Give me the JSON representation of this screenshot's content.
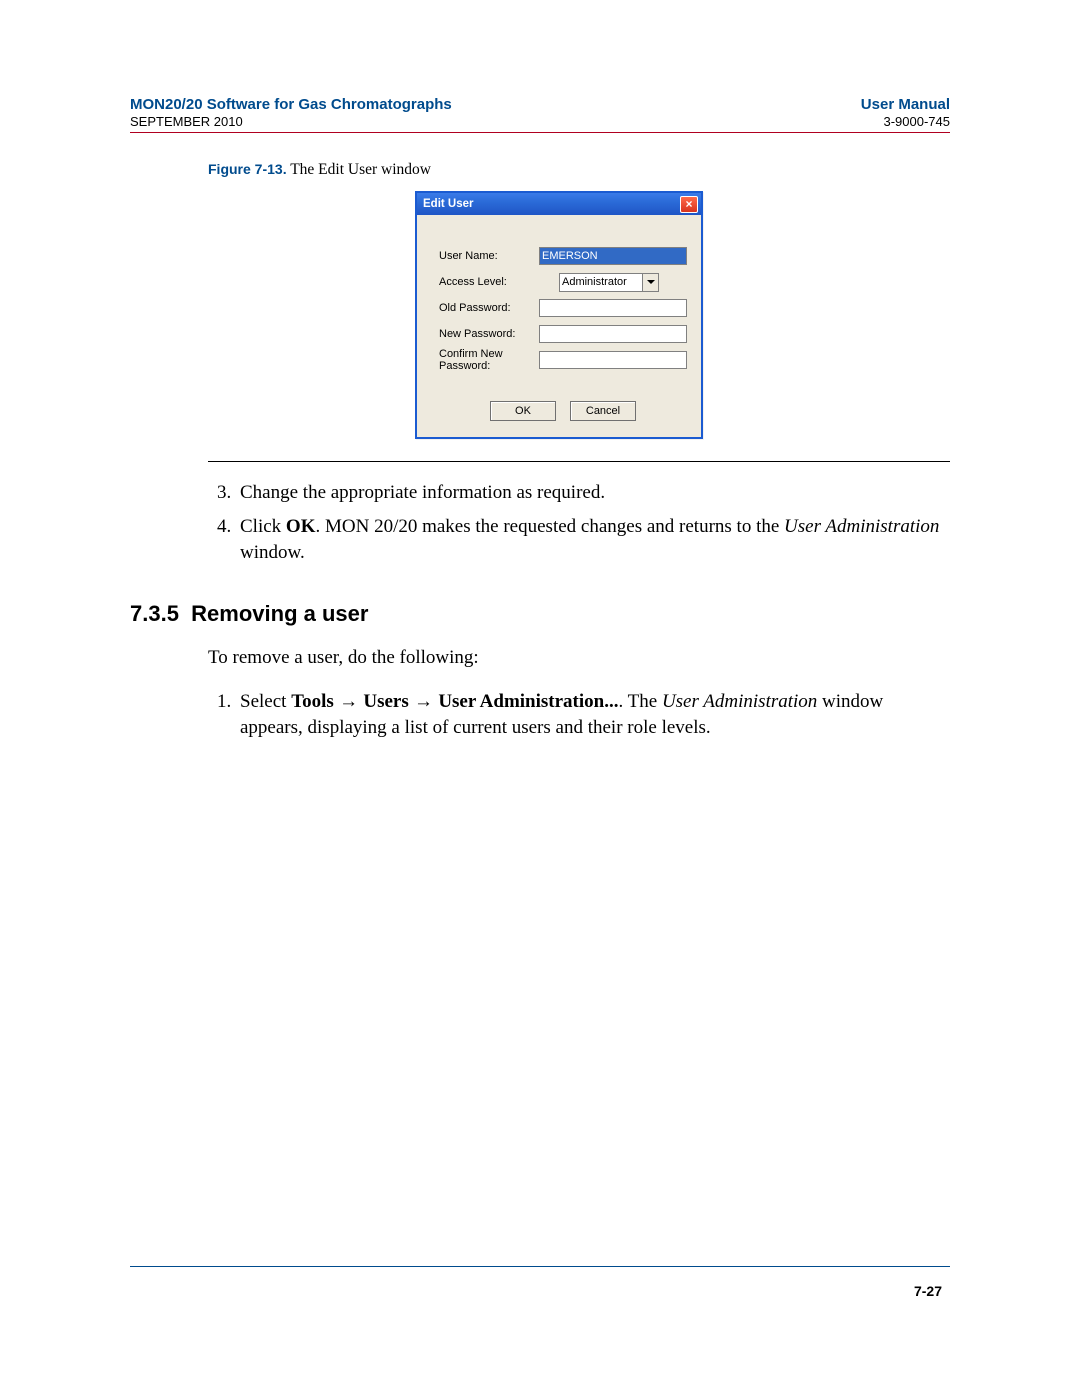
{
  "header": {
    "title": "MON20/20 Software for Gas Chromatographs",
    "manual": "User Manual",
    "date": "SEPTEMBER 2010",
    "docnum": "3-9000-745"
  },
  "figure": {
    "label": "Figure 7-13.",
    "caption": "The Edit User window"
  },
  "dialog": {
    "title": "Edit User",
    "fields": {
      "username_label": "User Name:",
      "username_value": "EMERSON",
      "access_label": "Access Level:",
      "access_value": "Administrator",
      "oldpw_label": "Old Password:",
      "oldpw_value": "",
      "newpw_label": "New Password:",
      "newpw_value": "",
      "confirm_label": "Confirm New Password:",
      "confirm_value": ""
    },
    "buttons": {
      "ok": "OK",
      "cancel": "Cancel"
    }
  },
  "steps_a": {
    "s3": "Change the appropriate information as required.",
    "s4_pre": "Click ",
    "s4_ok": "OK",
    "s4_mid": ".  MON 20/20 makes the requested changes and returns to the ",
    "s4_italic": "User Administration",
    "s4_post": " window."
  },
  "section": {
    "number": "7.3.5",
    "title": "Removing a user",
    "intro": "To remove a user, do the following:"
  },
  "steps_b": {
    "s1_pre": "Select ",
    "s1_tools": "Tools",
    "s1_arrow": " → ",
    "s1_users": "Users",
    "s1_admin": "User Administration...",
    "s1_mid": ".   The ",
    "s1_italic": "User Administration",
    "s1_post": " window appears, displaying a list of current users and their role levels."
  },
  "footer": {
    "page": "7-27"
  }
}
